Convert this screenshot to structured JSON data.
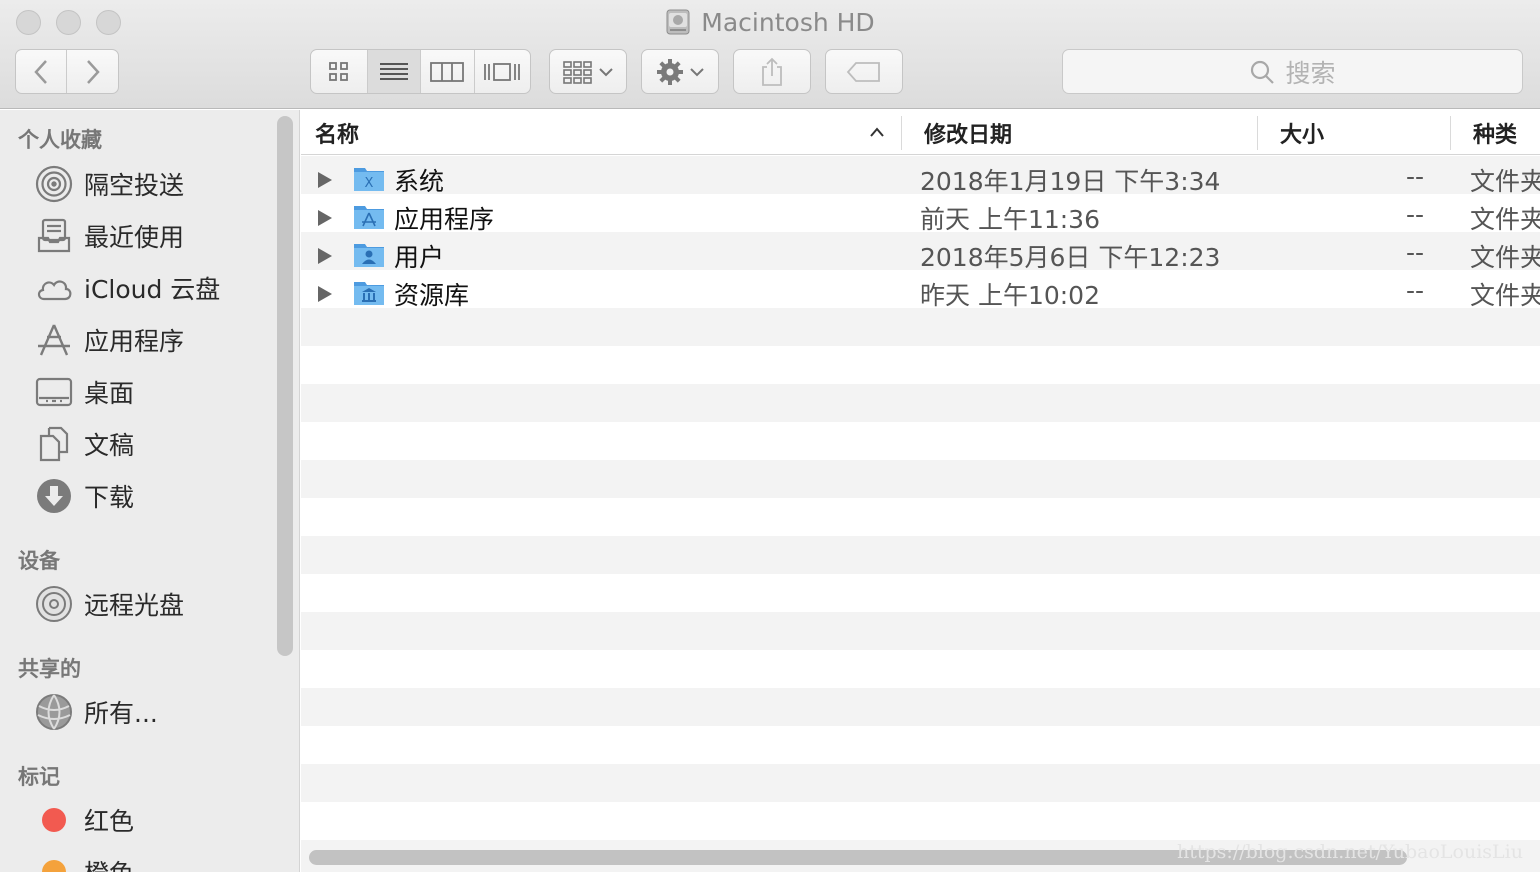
{
  "window": {
    "title": "Macintosh HD"
  },
  "toolbar": {
    "back_icon": "chevron-left-icon",
    "forward_icon": "chevron-right-icon",
    "view_modes": [
      "icon-view",
      "list-view",
      "column-view",
      "cover-flow-view"
    ],
    "active_view": "list-view",
    "search_placeholder": "搜索"
  },
  "sidebar": {
    "sections": [
      {
        "title": "个人收藏",
        "items": [
          {
            "label": "隔空投送",
            "icon": "airdrop-icon"
          },
          {
            "label": "最近使用",
            "icon": "recents-icon"
          },
          {
            "label": "iCloud 云盘",
            "icon": "cloud-icon"
          },
          {
            "label": "应用程序",
            "icon": "applications-icon"
          },
          {
            "label": "桌面",
            "icon": "desktop-icon"
          },
          {
            "label": "文稿",
            "icon": "documents-icon"
          },
          {
            "label": "下载",
            "icon": "download-icon"
          }
        ]
      },
      {
        "title": "设备",
        "items": [
          {
            "label": "远程光盘",
            "icon": "disc-icon"
          }
        ]
      },
      {
        "title": "共享的",
        "items": [
          {
            "label": "所有...",
            "icon": "network-icon"
          }
        ]
      },
      {
        "title": "标记",
        "items": [
          {
            "label": "红色",
            "icon": "tag-red-icon",
            "color": "#f25a50"
          },
          {
            "label": "橙色",
            "icon": "tag-orange-icon",
            "color": "#f4a23c"
          }
        ]
      }
    ]
  },
  "list": {
    "columns": [
      "名称",
      "修改日期",
      "大小",
      "种类"
    ],
    "sort_column": "名称",
    "rows": [
      {
        "name": "系统",
        "date": "2018年1月19日 下午3:34",
        "size": "--",
        "kind": "文件夹",
        "icon": "system-folder-icon"
      },
      {
        "name": "应用程序",
        "date": "前天 上午11:36",
        "size": "--",
        "kind": "文件夹",
        "icon": "applications-folder-icon"
      },
      {
        "name": "用户",
        "date": "2018年5月6日 下午12:23",
        "size": "--",
        "kind": "文件夹",
        "icon": "users-folder-icon"
      },
      {
        "name": "资源库",
        "date": "昨天 上午10:02",
        "size": "--",
        "kind": "文件夹",
        "icon": "library-folder-icon"
      }
    ]
  },
  "watermark": "https://blog.csdn.net/YubaoLouisLiu",
  "colors": {
    "folder_blue": "#6fb6ea",
    "folder_dark": "#4d9be0",
    "sidebar_bg": "#ececec"
  }
}
